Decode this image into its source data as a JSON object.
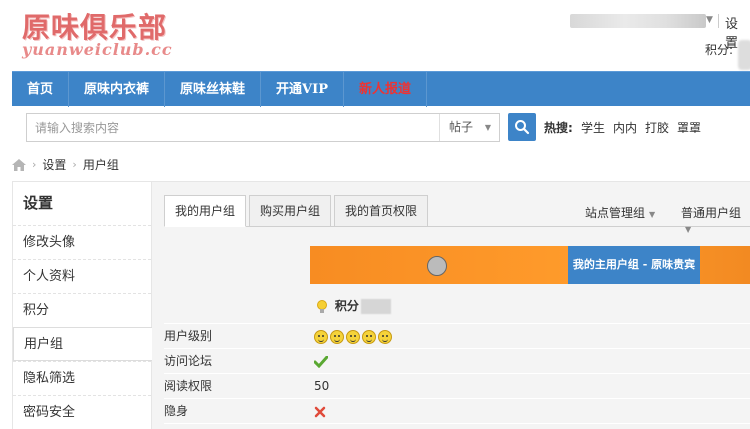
{
  "header": {
    "logo_cn": "原味俱乐部",
    "logo_en": "yuanweiclub.cc",
    "settings_link": "设置",
    "points_label": "积分:"
  },
  "nav": {
    "items": [
      {
        "label": "首页"
      },
      {
        "label": "原味内衣裤"
      },
      {
        "label": "原味丝袜鞋"
      },
      {
        "label": "开通VIP"
      },
      {
        "label": "新人报道"
      }
    ],
    "hot_color": "#ee3333"
  },
  "search": {
    "placeholder": "请输入搜索内容",
    "type": "帖子",
    "hot_label": "热搜:",
    "hot_links": [
      "学生",
      "内内",
      "打胶",
      "罩罩"
    ]
  },
  "breadcrumb": {
    "items": [
      "设置",
      "用户组"
    ]
  },
  "sidebar": {
    "title": "设置",
    "items": [
      {
        "label": "修改头像"
      },
      {
        "label": "个人资料"
      },
      {
        "label": "积分"
      },
      {
        "label": "用户组"
      },
      {
        "label": "隐私筛选"
      },
      {
        "label": "密码安全"
      }
    ]
  },
  "main": {
    "tabs": [
      {
        "label": "我的用户组"
      },
      {
        "label": "购买用户组"
      },
      {
        "label": "我的首页权限"
      }
    ],
    "right_links": [
      "站点管理组",
      "普通用户组"
    ],
    "group_label": "我的主用户组 - 原味贵宾",
    "points_row_label": "积分",
    "rows": [
      {
        "label": "用户级别"
      },
      {
        "label": "访问论坛"
      },
      {
        "label": "阅读权限",
        "value": "50"
      },
      {
        "label": "隐身"
      }
    ],
    "user_level_stars": 5
  },
  "colors": {
    "accent_blue": "#3d84c8",
    "orange": "#f78c22",
    "check_green": "#5aa832",
    "cross_red": "#e04a3a"
  }
}
